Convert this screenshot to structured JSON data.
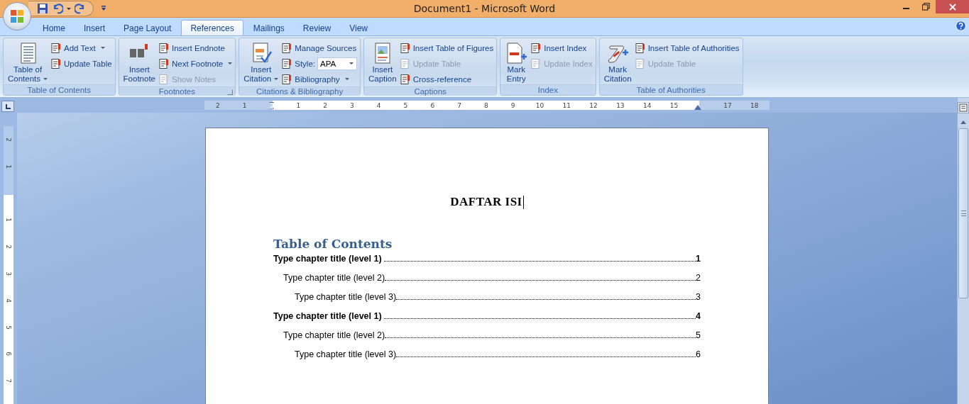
{
  "window": {
    "title": "Document1 - Microsoft Word"
  },
  "tabs": [
    {
      "label": "Home",
      "selected": false
    },
    {
      "label": "Insert",
      "selected": false
    },
    {
      "label": "Page Layout",
      "selected": false
    },
    {
      "label": "References",
      "selected": true
    },
    {
      "label": "Mailings",
      "selected": false
    },
    {
      "label": "Review",
      "selected": false
    },
    {
      "label": "View",
      "selected": false
    }
  ],
  "ribbon": {
    "groups": [
      {
        "name": "Table of Contents",
        "launcher": false,
        "large": [
          {
            "label": "Table of\nContents",
            "dropdown": true
          }
        ],
        "small": [
          {
            "kind": "button",
            "label": "Add Text",
            "dropdown": true,
            "disabled": false
          },
          {
            "kind": "button",
            "label": "Update Table",
            "dropdown": false,
            "disabled": false
          }
        ]
      },
      {
        "name": "Footnotes",
        "launcher": true,
        "large": [
          {
            "label": "Insert\nFootnote",
            "dropdown": false
          }
        ],
        "small": [
          {
            "kind": "button",
            "label": "Insert Endnote",
            "dropdown": false,
            "disabled": false
          },
          {
            "kind": "button",
            "label": "Next Footnote",
            "dropdown": true,
            "disabled": false
          },
          {
            "kind": "button",
            "label": "Show Notes",
            "dropdown": false,
            "disabled": true
          }
        ]
      },
      {
        "name": "Citations & Bibliography",
        "launcher": false,
        "large": [
          {
            "label": "Insert\nCitation",
            "dropdown": true
          }
        ],
        "small": [
          {
            "kind": "button",
            "label": "Manage Sources",
            "dropdown": false,
            "disabled": false
          },
          {
            "kind": "field",
            "label": "Style:",
            "value": "APA"
          },
          {
            "kind": "button",
            "label": "Bibliography",
            "dropdown": true,
            "disabled": false
          }
        ]
      },
      {
        "name": "Captions",
        "launcher": false,
        "large": [
          {
            "label": "Insert\nCaption",
            "dropdown": false
          }
        ],
        "small": [
          {
            "kind": "button",
            "label": "Insert Table of Figures",
            "dropdown": false,
            "disabled": false
          },
          {
            "kind": "button",
            "label": "Update Table",
            "dropdown": false,
            "disabled": true
          },
          {
            "kind": "button",
            "label": "Cross-reference",
            "dropdown": false,
            "disabled": false
          }
        ]
      },
      {
        "name": "Index",
        "launcher": false,
        "large": [
          {
            "label": "Mark\nEntry",
            "dropdown": false
          }
        ],
        "small": [
          {
            "kind": "button",
            "label": "Insert Index",
            "dropdown": false,
            "disabled": false
          },
          {
            "kind": "button",
            "label": "Update Index",
            "dropdown": false,
            "disabled": true
          }
        ]
      },
      {
        "name": "Table of Authorities",
        "launcher": false,
        "large": [
          {
            "label": "Mark\nCitation",
            "dropdown": false
          }
        ],
        "small": [
          {
            "kind": "button",
            "label": "Insert Table of Authorities",
            "dropdown": false,
            "disabled": false
          },
          {
            "kind": "button",
            "label": "Update Table",
            "dropdown": false,
            "disabled": true
          }
        ]
      }
    ]
  },
  "horizontal_ruler": {
    "left_margin_labels": [
      "2",
      "1"
    ],
    "body_labels": [
      "1",
      "2",
      "3",
      "4",
      "5",
      "6",
      "7",
      "8",
      "9",
      "10",
      "11",
      "12",
      "13",
      "14",
      "15"
    ],
    "right_margin_labels": [
      "17",
      "18"
    ]
  },
  "vertical_ruler": {
    "top_margin_labels": [
      "2",
      "1"
    ],
    "body_labels": [
      "1",
      "2",
      "3",
      "4",
      "5",
      "6",
      "7"
    ]
  },
  "document": {
    "heading": "DAFTAR ISI",
    "toc_title": "Table of Contents",
    "toc": [
      {
        "text": "Type chapter title (level 1)",
        "page": "1",
        "children": [
          {
            "text": "Type chapter title (level 2)",
            "page": "2",
            "children": [
              {
                "text": "Type chapter title (level 3)",
                "page": "3"
              }
            ]
          }
        ]
      },
      {
        "text": "Type chapter title (level 1)",
        "page": "4",
        "children": [
          {
            "text": "Type chapter title (level 2)",
            "page": "5",
            "children": [
              {
                "text": "Type chapter title (level 3)",
                "page": "6"
              }
            ]
          }
        ]
      }
    ]
  }
}
